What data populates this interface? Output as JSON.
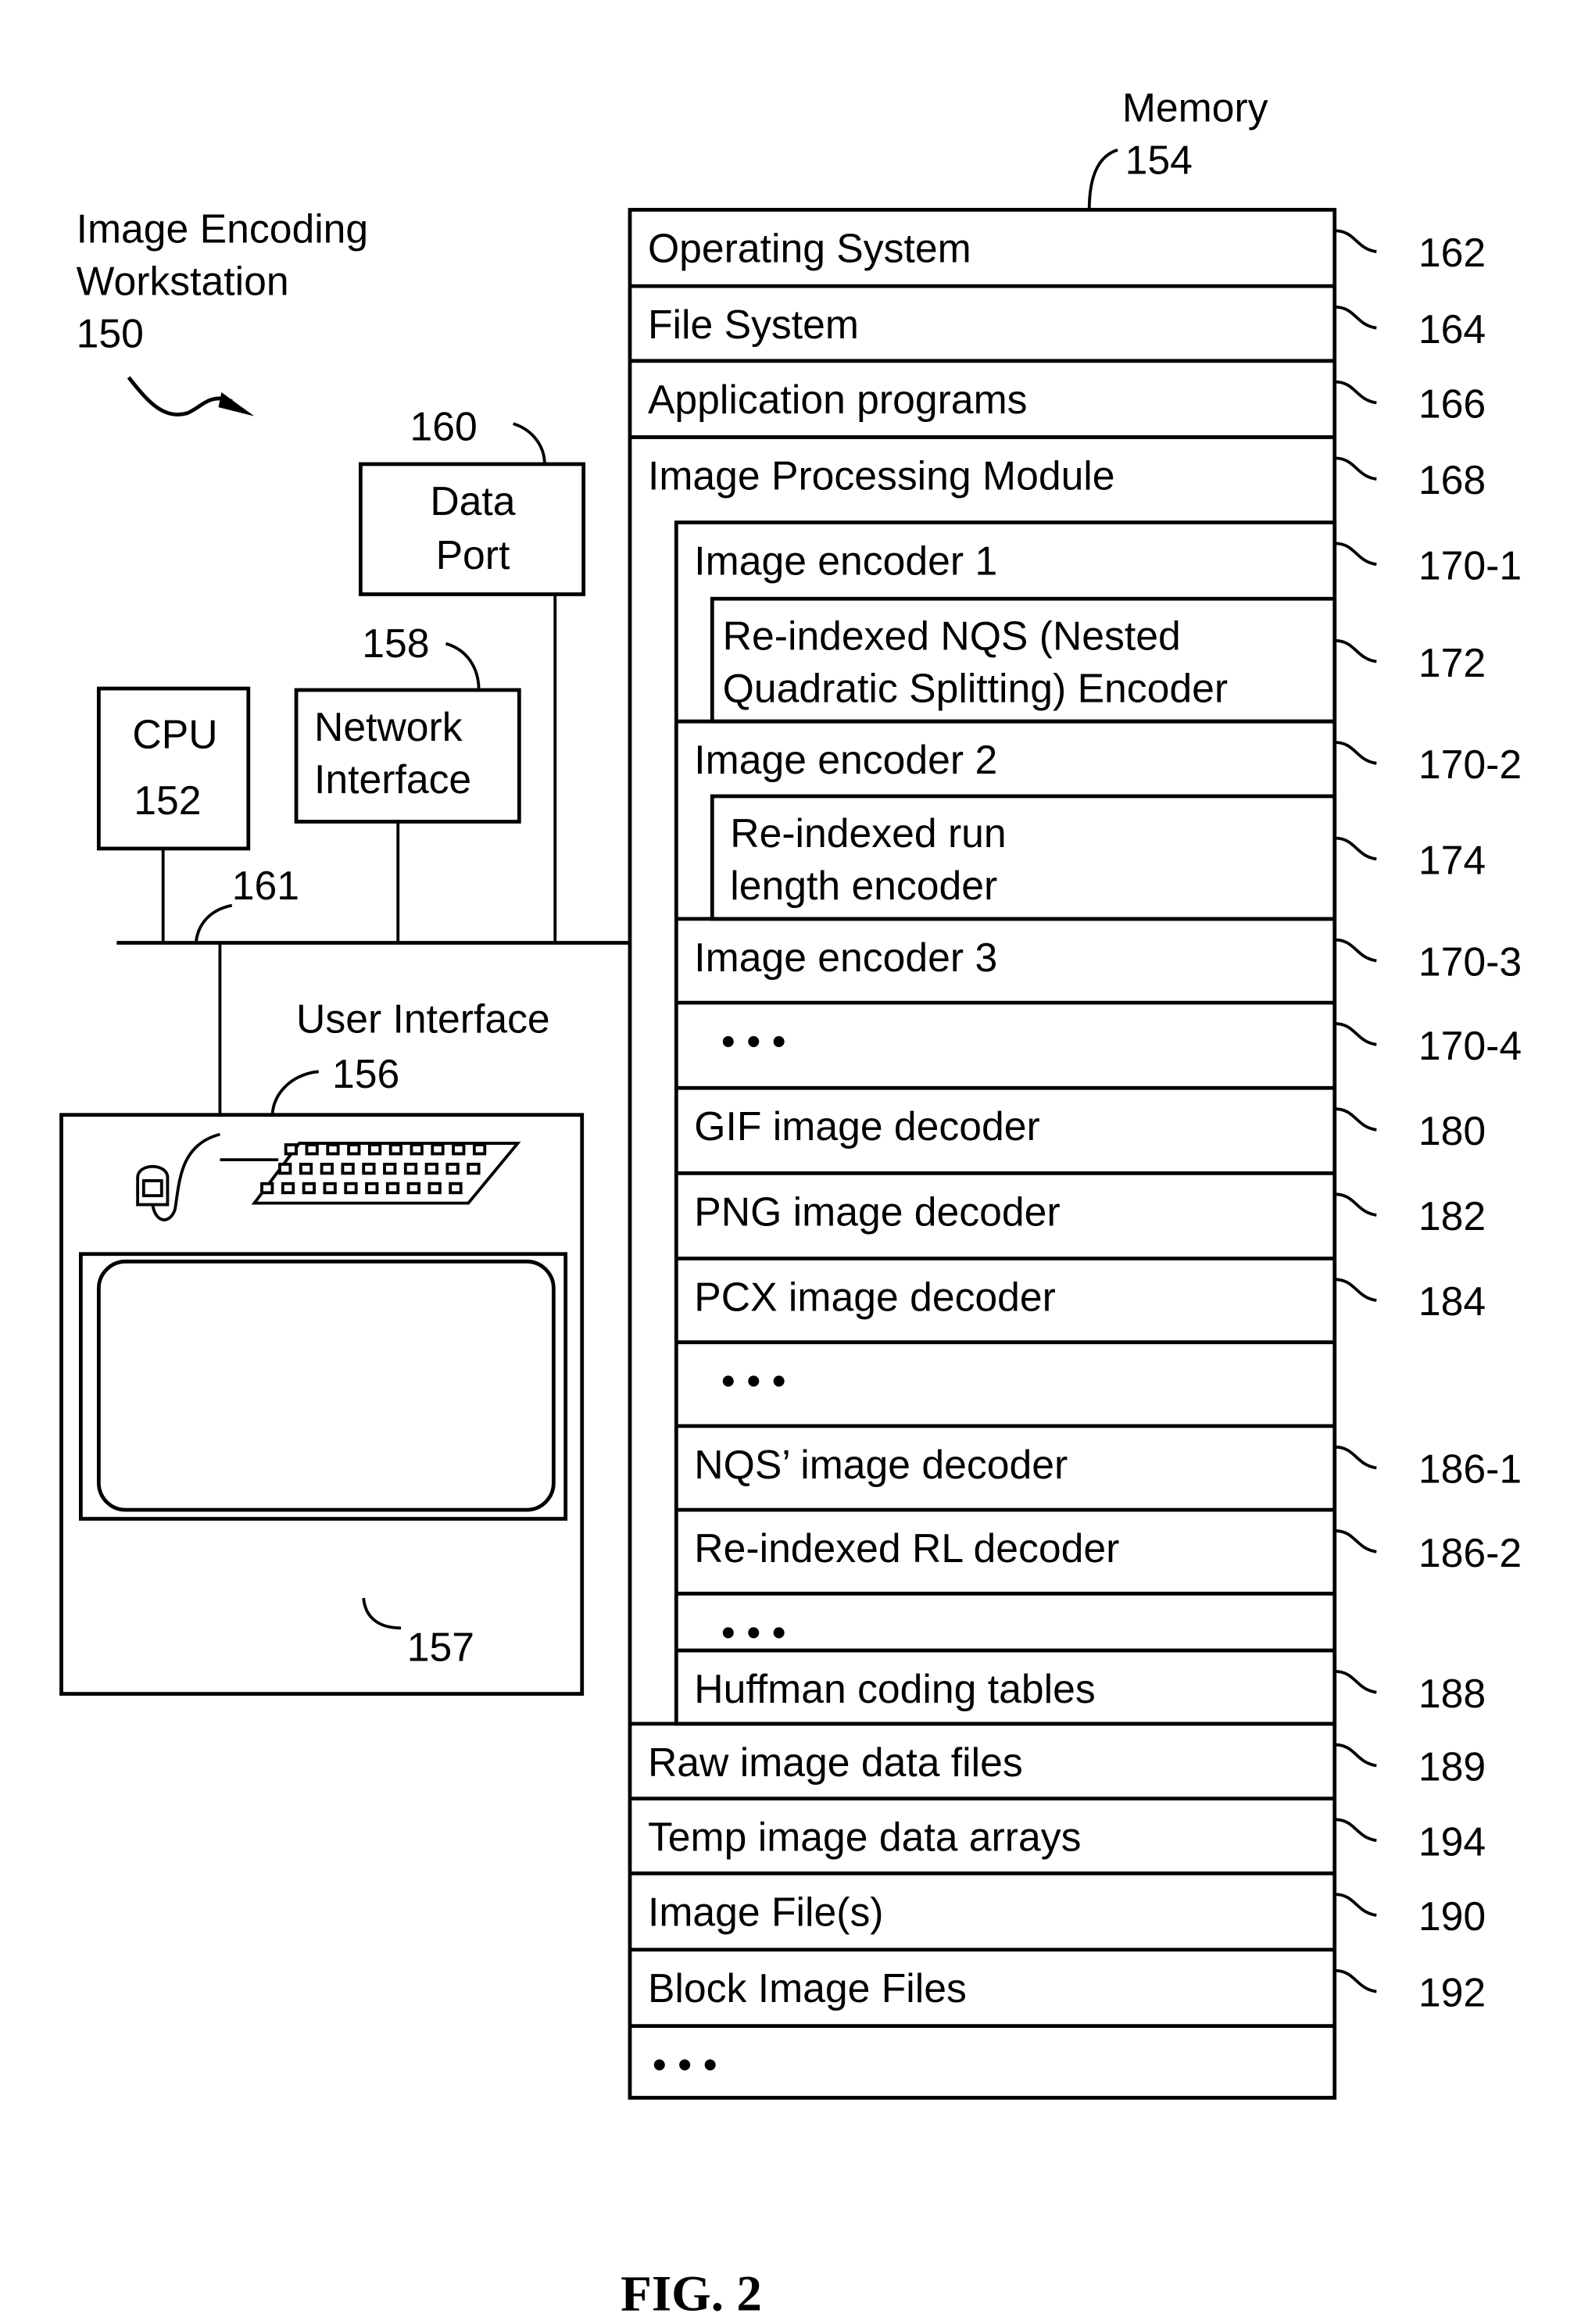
{
  "workstation": {
    "title_line1": "Image Encoding",
    "title_line2": "Workstation",
    "ref": "150"
  },
  "cpu": {
    "label": "CPU",
    "ref": "152"
  },
  "network_interface": {
    "line1": "Network",
    "line2": "Interface",
    "ref": "158"
  },
  "data_port": {
    "line1": "Data",
    "line2": "Port",
    "ref": "160"
  },
  "bus": {
    "ref": "161"
  },
  "user_interface": {
    "label": "User Interface",
    "ref": "156",
    "display_ref": "157"
  },
  "memory": {
    "label": "Memory",
    "ref": "154",
    "top_rows": [
      {
        "label": "Operating System",
        "ref": "162"
      },
      {
        "label": "File System",
        "ref": "164"
      },
      {
        "label": "Application programs",
        "ref": "166"
      },
      {
        "label": "Image Processing Module",
        "ref": "168"
      }
    ],
    "module_rows": [
      {
        "label": "Image encoder 1",
        "ref": "170-1"
      },
      {
        "label_line1": "Re-indexed NQS (Nested",
        "label_line2": "Quadratic Splitting) Encoder",
        "ref": "172"
      },
      {
        "label": "Image encoder 2",
        "ref": "170-2"
      },
      {
        "label_line1": "Re-indexed run",
        "label_line2": "length encoder",
        "ref": "174"
      },
      {
        "label": "Image encoder 3",
        "ref": "170-3"
      },
      {
        "label": "• • •",
        "ref": "170-4"
      },
      {
        "label": "GIF image decoder",
        "ref": "180"
      },
      {
        "label": "PNG image decoder",
        "ref": "182"
      },
      {
        "label": "PCX image decoder",
        "ref": "184"
      },
      {
        "label": "• • •",
        "ref": ""
      },
      {
        "label": "NQS’ image decoder",
        "ref": "186-1"
      },
      {
        "label": "Re-indexed RL decoder",
        "ref": "186-2"
      },
      {
        "label": "• • •",
        "ref": ""
      },
      {
        "label": "Huffman coding tables",
        "ref": "188"
      }
    ],
    "bottom_rows": [
      {
        "label": "Raw image data files",
        "ref": "189"
      },
      {
        "label": "Temp image data arrays",
        "ref": "194"
      },
      {
        "label": "Image File(s)",
        "ref": "190"
      },
      {
        "label": "Block Image Files",
        "ref": "192"
      },
      {
        "label": "• • •",
        "ref": ""
      }
    ]
  },
  "figure_caption": "FIG. 2"
}
